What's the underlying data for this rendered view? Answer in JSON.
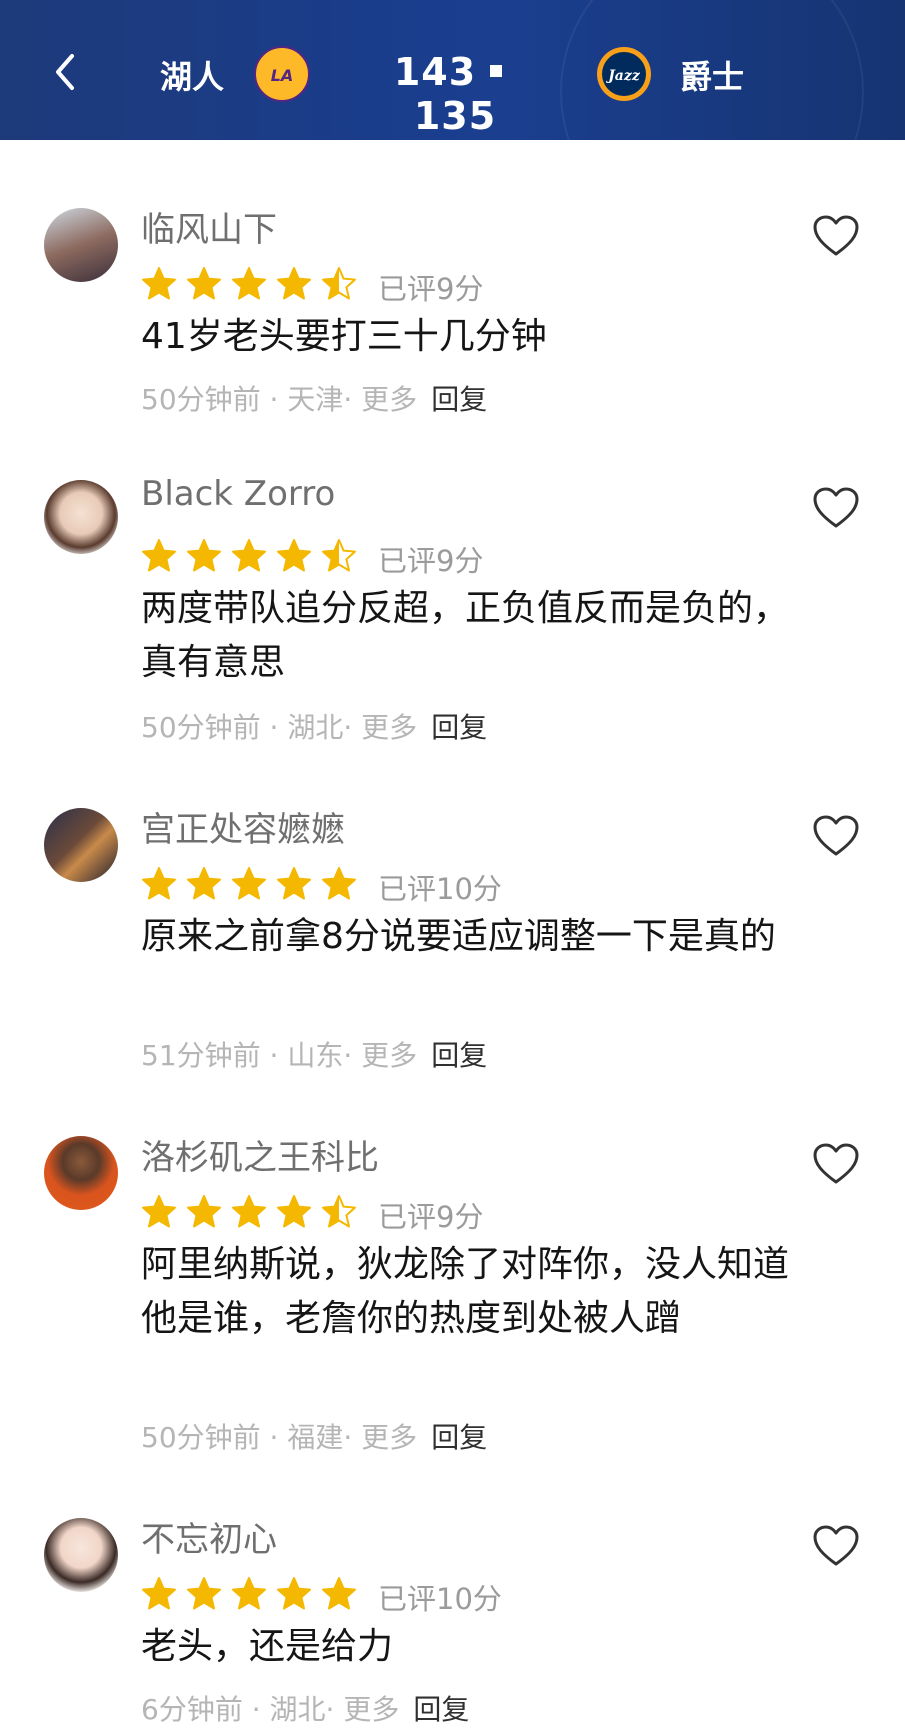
{
  "header": {
    "home_team": "湖人",
    "away_team": "爵士",
    "home_score": "143",
    "away_score": "135",
    "home_logo_color": "#f4b63a",
    "away_logo_color": "#1a2b4a"
  },
  "comments": [
    {
      "name": "临风山下",
      "stars": 4.5,
      "rating_text": "已评9分",
      "text": "41岁老头要打三十几分钟",
      "time": "50分钟前",
      "sep1": " · ",
      "location": "天津",
      "sep2": "· ",
      "more": "更多",
      "reply": "回复"
    },
    {
      "name": "Black Zorro",
      "stars": 4.5,
      "rating_text": "已评9分",
      "text": "两度带队追分反超，正负值反而是负的，真有意思",
      "time": "50分钟前",
      "sep1": " · ",
      "location": "湖北",
      "sep2": "· ",
      "more": "更多",
      "reply": "回复"
    },
    {
      "name": "宫正处容嬷嬷",
      "stars": 5,
      "rating_text": "已评10分",
      "text": "原来之前拿8分说要适应调整一下是真的",
      "time": "51分钟前",
      "sep1": " · ",
      "location": "山东",
      "sep2": "· ",
      "more": "更多",
      "reply": "回复"
    },
    {
      "name": "洛杉矶之王科比",
      "stars": 4.5,
      "rating_text": "已评9分",
      "text": "阿里纳斯说，狄龙除了对阵你，没人知道他是谁，老詹你的热度到处被人蹭",
      "time": "50分钟前",
      "sep1": " · ",
      "location": "福建",
      "sep2": "· ",
      "more": "更多",
      "reply": "回复"
    },
    {
      "name": "不忘初心",
      "stars": 5,
      "rating_text": "已评10分",
      "text": "老头，还是给力",
      "time": "6分钟前",
      "sep1": " · ",
      "location": "湖北",
      "sep2": "· ",
      "more": "更多",
      "reply": "回复"
    }
  ],
  "colors": {
    "star": "#f5b800",
    "header_bg": "#1b3d88"
  }
}
